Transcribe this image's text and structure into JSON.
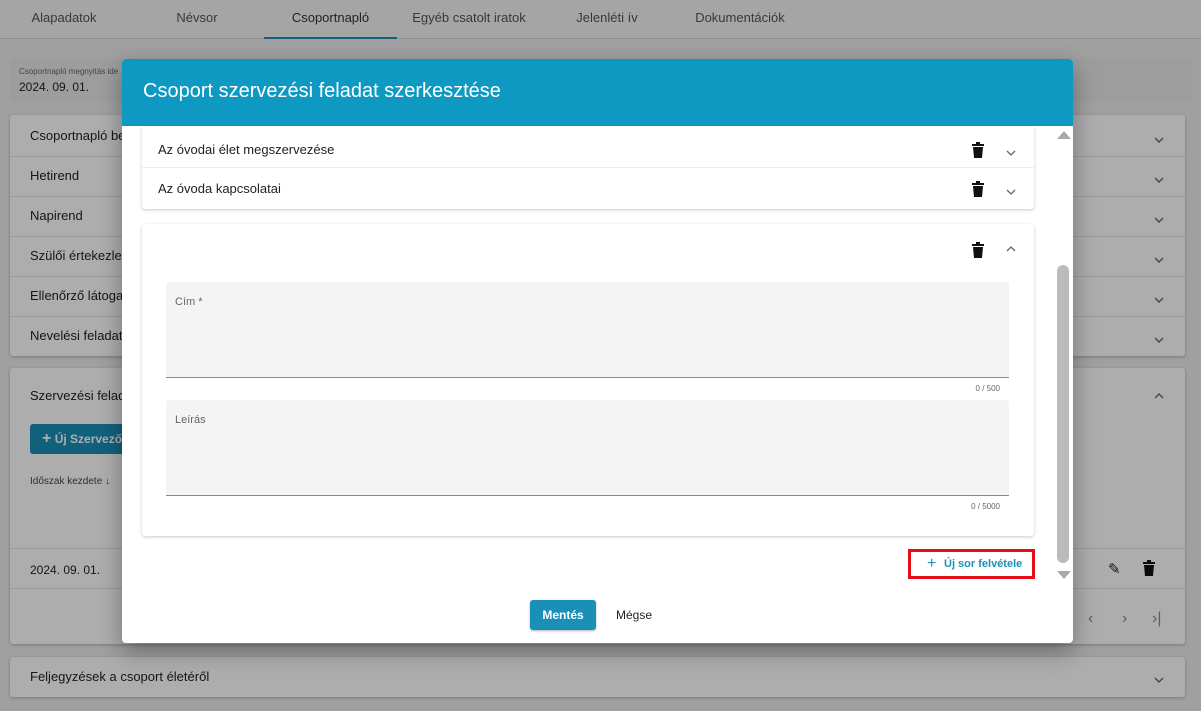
{
  "tabs": [
    "Alapadatok",
    "Névsor",
    "Csoportnapló",
    "Egyéb csatolt iratok",
    "Jelenléti ív",
    "Dokumentációk"
  ],
  "active_tab": "Csoportnapló",
  "background": {
    "info_small_label": "Csoportnapló megnyitás ide",
    "info_date": "2024. 09. 01.",
    "sections": [
      "Csoportnapló be",
      "Hetirend",
      "Napirend",
      "Szülői értekezlet",
      "Ellenőrző látogat",
      "Nevelési feladato"
    ],
    "organizing_section": "Szervezési felada",
    "new_button": "Új Szervező",
    "sort_label": "Időszak kezdete",
    "row_date": "2024. 09. 01.",
    "notes_section": "Feljegyzések a csoport életéről"
  },
  "modal": {
    "title": "Csoport szervezési feladat szerkesztése",
    "items": [
      "Az óvodai élet megszervezése",
      "Az óvoda kapcsolatai"
    ],
    "title_field_label": "Cím *",
    "title_field_counter": "0 / 500",
    "description_field_label": "Leírás",
    "description_field_counter": "0 / 5000",
    "add_row_label": "Új sor felvétele",
    "save_label": "Mentés",
    "cancel_label": "Mégse"
  },
  "colors": {
    "primary": "#0e99c3",
    "highlight": "#e3101c"
  },
  "icons": [
    "trash-icon",
    "chevron-down-icon",
    "chevron-up-icon",
    "plus-icon",
    "pencil-icon",
    "arrow-down-icon"
  ]
}
